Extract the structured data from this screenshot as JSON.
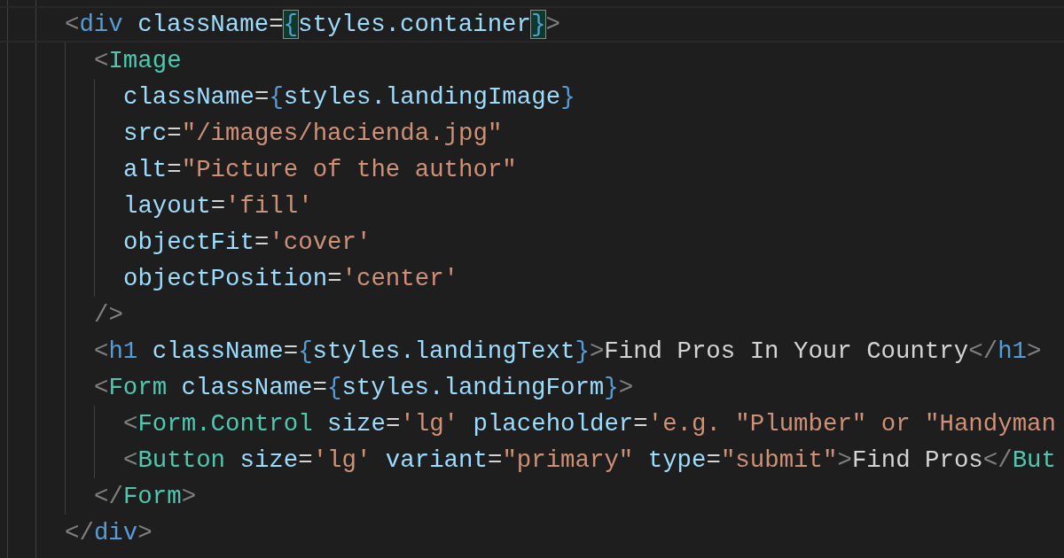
{
  "editor": {
    "lines": [
      {
        "current": true,
        "tokens": [
          {
            "kind": "punct",
            "text": "<"
          },
          {
            "kind": "tag",
            "text": "div"
          },
          {
            "kind": "attr",
            "text": " className"
          },
          {
            "kind": "op",
            "text": "="
          },
          {
            "kind": "brace-matched",
            "text": "{"
          },
          {
            "kind": "expr",
            "text": "styles.container"
          },
          {
            "kind": "brace-matched",
            "text": "}"
          },
          {
            "kind": "punct",
            "text": ">"
          }
        ],
        "children": [
          {
            "current": false,
            "tokens": [
              {
                "kind": "punct",
                "text": "<"
              },
              {
                "kind": "component",
                "text": "Image"
              }
            ],
            "children": [
              {
                "current": false,
                "tokens": [
                  {
                    "kind": "attr",
                    "text": "className"
                  },
                  {
                    "kind": "op",
                    "text": "="
                  },
                  {
                    "kind": "brace",
                    "text": "{"
                  },
                  {
                    "kind": "expr",
                    "text": "styles.landingImage"
                  },
                  {
                    "kind": "brace",
                    "text": "}"
                  }
                ]
              },
              {
                "current": false,
                "tokens": [
                  {
                    "kind": "attr",
                    "text": "src"
                  },
                  {
                    "kind": "op",
                    "text": "="
                  },
                  {
                    "kind": "string",
                    "text": "\"/images/hacienda.jpg\""
                  }
                ]
              },
              {
                "current": false,
                "tokens": [
                  {
                    "kind": "attr",
                    "text": "alt"
                  },
                  {
                    "kind": "op",
                    "text": "="
                  },
                  {
                    "kind": "string",
                    "text": "\"Picture of the author\""
                  }
                ]
              },
              {
                "current": false,
                "tokens": [
                  {
                    "kind": "attr",
                    "text": "layout"
                  },
                  {
                    "kind": "op",
                    "text": "="
                  },
                  {
                    "kind": "string",
                    "text": "'fill'"
                  }
                ]
              },
              {
                "current": false,
                "tokens": [
                  {
                    "kind": "attr",
                    "text": "objectFit"
                  },
                  {
                    "kind": "op",
                    "text": "="
                  },
                  {
                    "kind": "string",
                    "text": "'cover'"
                  }
                ]
              },
              {
                "current": false,
                "tokens": [
                  {
                    "kind": "attr",
                    "text": "objectPosition"
                  },
                  {
                    "kind": "op",
                    "text": "="
                  },
                  {
                    "kind": "string",
                    "text": "'center'"
                  }
                ]
              }
            ]
          },
          {
            "current": false,
            "tokens": [
              {
                "kind": "punct",
                "text": "/>"
              }
            ]
          },
          {
            "current": false,
            "tokens": [
              {
                "kind": "punct",
                "text": "<"
              },
              {
                "kind": "tag",
                "text": "h1"
              },
              {
                "kind": "attr",
                "text": " className"
              },
              {
                "kind": "op",
                "text": "="
              },
              {
                "kind": "brace",
                "text": "{"
              },
              {
                "kind": "expr",
                "text": "styles.landingText"
              },
              {
                "kind": "brace",
                "text": "}"
              },
              {
                "kind": "punct",
                "text": ">"
              },
              {
                "kind": "text",
                "text": "Find Pros In Your Country"
              },
              {
                "kind": "punct",
                "text": "</"
              },
              {
                "kind": "tag",
                "text": "h1"
              },
              {
                "kind": "punct",
                "text": ">"
              }
            ]
          },
          {
            "current": false,
            "tokens": [
              {
                "kind": "punct",
                "text": "<"
              },
              {
                "kind": "component",
                "text": "Form"
              },
              {
                "kind": "attr",
                "text": " className"
              },
              {
                "kind": "op",
                "text": "="
              },
              {
                "kind": "brace",
                "text": "{"
              },
              {
                "kind": "expr",
                "text": "styles.landingForm"
              },
              {
                "kind": "brace",
                "text": "}"
              },
              {
                "kind": "punct",
                "text": ">"
              }
            ],
            "children": [
              {
                "current": false,
                "tokens": [
                  {
                    "kind": "punct",
                    "text": "<"
                  },
                  {
                    "kind": "component",
                    "text": "Form.Control"
                  },
                  {
                    "kind": "attr",
                    "text": " size"
                  },
                  {
                    "kind": "op",
                    "text": "="
                  },
                  {
                    "kind": "string",
                    "text": "'lg'"
                  },
                  {
                    "kind": "attr",
                    "text": " placeholder"
                  },
                  {
                    "kind": "op",
                    "text": "="
                  },
                  {
                    "kind": "string",
                    "text": "'e.g. \"Plumber\" or \"Handyman"
                  }
                ]
              },
              {
                "current": false,
                "tokens": [
                  {
                    "kind": "punct",
                    "text": "<"
                  },
                  {
                    "kind": "component",
                    "text": "Button"
                  },
                  {
                    "kind": "attr",
                    "text": " size"
                  },
                  {
                    "kind": "op",
                    "text": "="
                  },
                  {
                    "kind": "string",
                    "text": "'lg'"
                  },
                  {
                    "kind": "attr",
                    "text": " variant"
                  },
                  {
                    "kind": "op",
                    "text": "="
                  },
                  {
                    "kind": "string",
                    "text": "\"primary\""
                  },
                  {
                    "kind": "attr",
                    "text": " type"
                  },
                  {
                    "kind": "op",
                    "text": "="
                  },
                  {
                    "kind": "string",
                    "text": "\"submit\""
                  },
                  {
                    "kind": "punct",
                    "text": ">"
                  },
                  {
                    "kind": "text",
                    "text": "Find Pros"
                  },
                  {
                    "kind": "punct",
                    "text": "</"
                  },
                  {
                    "kind": "component",
                    "text": "But"
                  }
                ]
              }
            ]
          },
          {
            "current": false,
            "tokens": [
              {
                "kind": "punct",
                "text": "</"
              },
              {
                "kind": "component",
                "text": "Form"
              },
              {
                "kind": "punct",
                "text": ">"
              }
            ]
          }
        ]
      },
      {
        "current": false,
        "tokens": [
          {
            "kind": "punct",
            "text": "</"
          },
          {
            "kind": "tag",
            "text": "div"
          },
          {
            "kind": "punct",
            "text": ">"
          }
        ]
      }
    ]
  }
}
